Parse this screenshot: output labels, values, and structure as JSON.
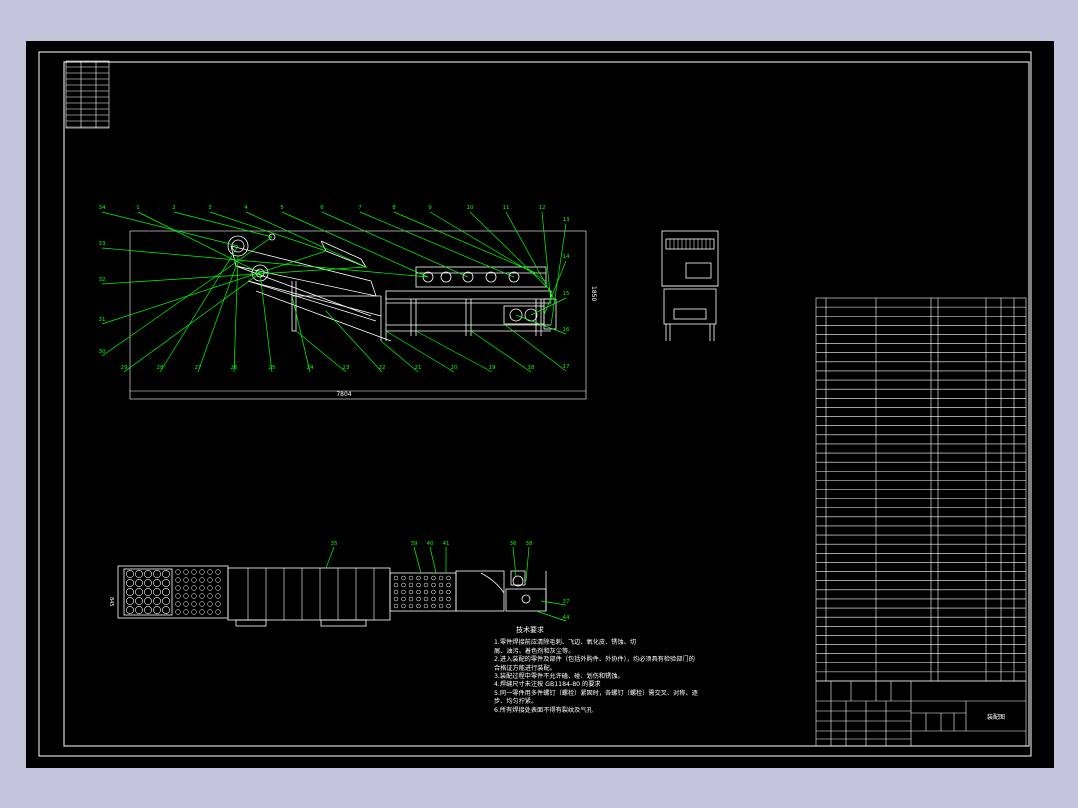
{
  "colors": {
    "background": "#c4c4dc",
    "sheet": "#000000",
    "frame": "#ffffff",
    "leader": "#00ff00",
    "geometry": "#ffffff"
  },
  "balloons_top": [
    "34",
    "1",
    "2",
    "3",
    "4",
    "5",
    "6",
    "7",
    "8",
    "9",
    "10",
    "11",
    "12",
    "13",
    "14",
    "15",
    "16",
    "17",
    "18",
    "19",
    "20",
    "21",
    "22",
    "23",
    "24",
    "25",
    "26",
    "27",
    "28",
    "29",
    "30",
    "31",
    "32",
    "33"
  ],
  "balloons_bottom": [
    "35",
    "39",
    "40",
    "41",
    "36",
    "38",
    "37",
    "44"
  ],
  "dimensions": {
    "overall_length": "7804",
    "overall_height": "1850",
    "plan_width": "845"
  },
  "notes": {
    "title": "技术要求",
    "lines": [
      "1.零件焊接前应清除毛刺、飞边、氧化皮、锈蚀、切",
      "  屑、油污、着色剂和灰尘等。",
      "2.进入装配的零件及部件（包括外购件、外协件），均必须具有检验部门的",
      "  合格证方能进行装配。",
      "3.装配过程中零件不允许磕、碰、划伤和锈蚀。",
      "4.焊缝尺寸未注按 GB1184-80 的要求",
      "5.同一零件用多件螺钉（螺栓）紧固时，各螺钉（螺栓）需交叉、对称、逐",
      "  步、均匀拧紧。",
      "6.所有焊接处表面不得有裂纹及气孔"
    ]
  },
  "bom_rows": 42,
  "title_block": {
    "drawing_name": "装配图"
  }
}
